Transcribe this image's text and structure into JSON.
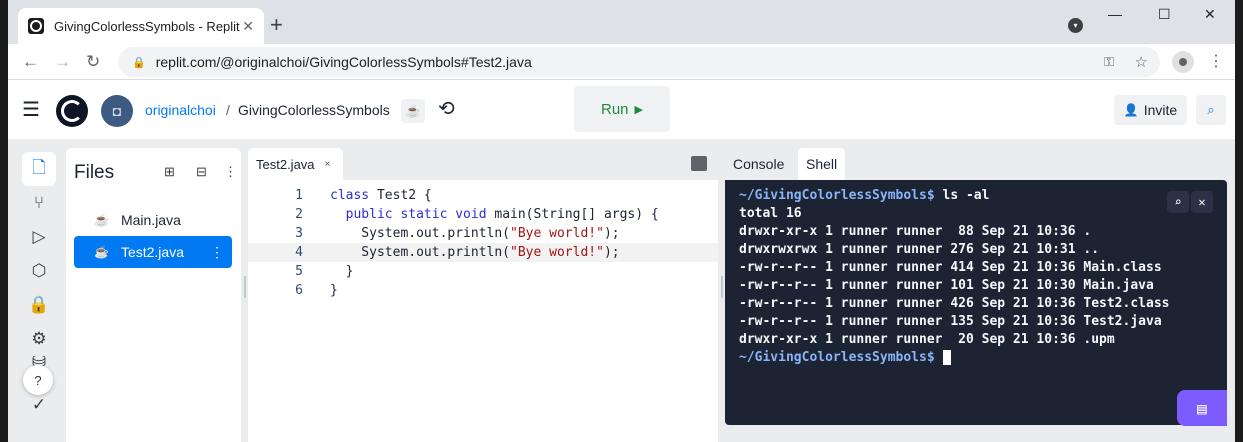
{
  "browser": {
    "tab_title": "GivingColorlessSymbols - Replit",
    "tab_close": "✕",
    "new_tab": "+",
    "url": "replit.com/@originalchoi/GivingColorlessSymbols#Test2.java",
    "window_controls": {
      "minimize": "—",
      "maximize": "☐",
      "close": "✕"
    }
  },
  "header": {
    "username": "originalchoi",
    "separator": "/",
    "repl_name": "GivingColorlessSymbols",
    "run_label": "Run",
    "invite_label": "Invite"
  },
  "files": {
    "title": "Files",
    "items": [
      {
        "name": "Main.java",
        "selected": false
      },
      {
        "name": "Test2.java",
        "selected": true
      }
    ]
  },
  "editor": {
    "tab_label": "Test2.java",
    "tab_close": "×",
    "line_numbers": [
      "1",
      "2",
      "3",
      "4",
      "5",
      "6"
    ],
    "highlighted_line": 4
  },
  "console": {
    "tabs": [
      "Console",
      "Shell"
    ],
    "active_tab": "Shell",
    "prompt": "~/GivingColorlessSymbols$",
    "command": " ls -al",
    "output": [
      "total 16",
      "drwxr-xr-x 1 runner runner  88 Sep 21 10:36 .",
      "drwxrwxrwx 1 runner runner 276 Sep 21 10:31 ..",
      "-rw-r--r-- 1 runner runner 414 Sep 21 10:36 Main.class",
      "-rw-r--r-- 1 runner runner 101 Sep 21 10:30 Main.java",
      "-rw-r--r-- 1 runner runner 426 Sep 21 10:36 Test2.class",
      "-rw-r--r-- 1 runner runner 135 Sep 21 10:36 Test2.java",
      "drwxr-xr-x 1 runner runner  20 Sep 21 10:36 .upm"
    ],
    "final_prompt": "~/GivingColorlessSymbols$"
  },
  "help_label": "?",
  "colors": {
    "accent": "#0079f2",
    "run_green": "#1f8a3b",
    "terminal_bg": "#1c2333",
    "chat_purple": "#7c5cff"
  }
}
